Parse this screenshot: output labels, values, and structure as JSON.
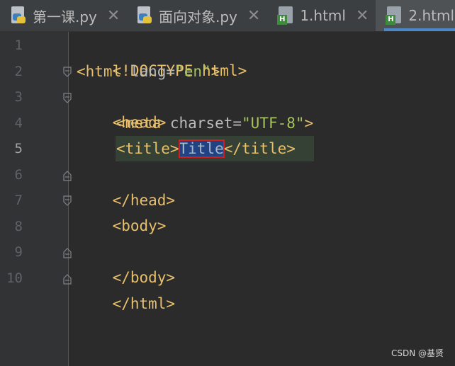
{
  "tabs": [
    {
      "label": "第一课.py",
      "icon": "python-file-icon",
      "active": false
    },
    {
      "label": "面向对象.py",
      "icon": "python-file-icon",
      "active": false
    },
    {
      "label": "1.html",
      "icon": "html-file-icon",
      "active": false
    },
    {
      "label": "2.html",
      "icon": "html-file-icon",
      "active": true
    }
  ],
  "close_glyph": "✕",
  "html_badge": "H",
  "line_numbers": [
    "1",
    "2",
    "3",
    "4",
    "5",
    "6",
    "7",
    "8",
    "9",
    "10"
  ],
  "current_line": "5",
  "code": {
    "l1": "<!DOCTYPE html>",
    "l2_tag_open": "<html ",
    "l2_attr": "lang=",
    "l2_str": "\"en\"",
    "l2_tag_close": ">",
    "l3": "<head>",
    "l4_tag_open": "<meta ",
    "l4_attr": "charset=",
    "l4_str": "\"UTF-8\"",
    "l4_tag_close": ">",
    "l5_open": "<title>",
    "l5_text": "Title",
    "l5_close": "</title>",
    "l6": "</head>",
    "l7": "<body>",
    "l8": "",
    "l9": "</body>",
    "l10": "</html>"
  },
  "colors": {
    "tag": "#e8bf6a",
    "string": "#a5c25c",
    "attribute": "#bababa",
    "selection": "#214283",
    "selection_outline": "#cc1f1f",
    "active_tab_underline": "#4a88c7"
  },
  "watermark": "CSDN @基贤"
}
